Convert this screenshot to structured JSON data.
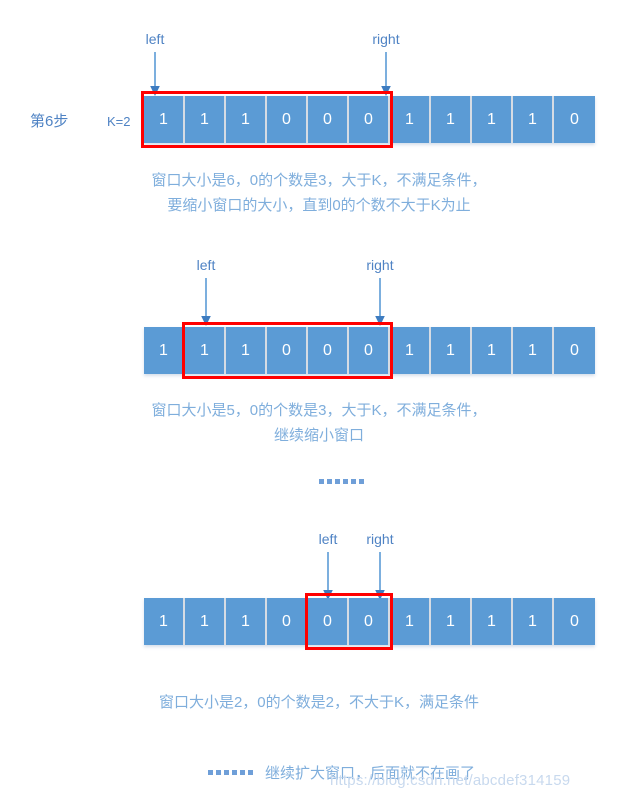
{
  "page": {
    "background": "#ffffff",
    "cell_color": "#5B9BD5",
    "window_color": "#FF0000",
    "text_color": "#7FAEDC",
    "watermark": "https://blog.csdn.net/abcdef314159"
  },
  "step": {
    "label": "第6步",
    "k_label": "K=2"
  },
  "pointers": {
    "left_label": "left",
    "right_label": "right"
  },
  "ellipsis": "……",
  "rows": [
    {
      "id": "row-1",
      "values": [
        "1",
        "1",
        "1",
        "0",
        "0",
        "0",
        "1",
        "1",
        "1",
        "1",
        "0"
      ],
      "window_start_index": 0,
      "window_end_index": 5,
      "left_pointer_index": 0,
      "right_pointer_index": 5,
      "caption_lines": [
        "窗口大小是6，0的个数是3，大于K，不满足条件，",
        "要缩小窗口的大小，直到0的个数不大于K为止"
      ]
    },
    {
      "id": "row-2",
      "values": [
        "1",
        "1",
        "1",
        "0",
        "0",
        "0",
        "1",
        "1",
        "1",
        "1",
        "0"
      ],
      "window_start_index": 1,
      "window_end_index": 5,
      "left_pointer_index": 1,
      "right_pointer_index": 5,
      "caption_lines": [
        "窗口大小是5，0的个数是3，大于K，不满足条件，",
        "继续缩小窗口"
      ]
    },
    {
      "id": "row-3",
      "values": [
        "1",
        "1",
        "1",
        "0",
        "0",
        "0",
        "1",
        "1",
        "1",
        "1",
        "0"
      ],
      "window_start_index": 4,
      "window_end_index": 5,
      "left_pointer_index": 4,
      "right_pointer_index": 5,
      "caption_lines": [
        "窗口大小是2，0的个数是2，不大于K，满足条件"
      ]
    }
  ],
  "bottom_note": {
    "text": "继续扩大窗口，后面就不在画了"
  }
}
